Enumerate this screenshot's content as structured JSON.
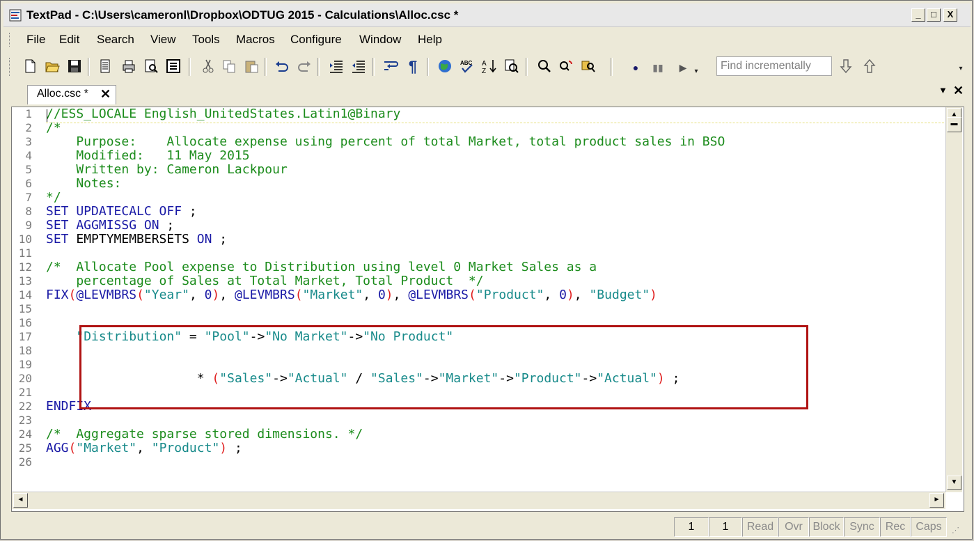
{
  "window": {
    "title": "TextPad - C:\\Users\\cameronl\\Dropbox\\ODTUG 2015 - Calculations\\Alloc.csc *",
    "buttons": {
      "minimize": "_",
      "maximize": "□",
      "close": "X"
    }
  },
  "menu": [
    "File",
    "Edit",
    "Search",
    "View",
    "Tools",
    "Macros",
    "Configure",
    "Window",
    "Help"
  ],
  "toolbar": {
    "icons": [
      "new-file-icon",
      "open-folder-icon",
      "save-icon",
      "page-icon",
      "print-icon",
      "print-preview-icon",
      "document-properties-icon",
      "cut-icon",
      "copy-icon",
      "paste-icon",
      "undo-icon",
      "redo-icon",
      "indent-icon",
      "outdent-icon",
      "word-wrap-icon",
      "pilcrow-icon",
      "web-browser-icon",
      "spell-check-icon",
      "sort-icon",
      "compare-icon",
      "find-icon",
      "find-next-icon",
      "find-in-files-icon",
      "record-macro-icon",
      "pause-macro-icon",
      "play-macro-icon"
    ],
    "find_placeholder": "Find incrementally"
  },
  "tab": {
    "label": "Alloc.csc *",
    "close": "✕"
  },
  "editor": {
    "line_numbers": [
      "1",
      "2",
      "3",
      "4",
      "5",
      "6",
      "7",
      "8",
      "9",
      "10",
      "11",
      "12",
      "13",
      "14",
      "15",
      "16",
      "17",
      "18",
      "19",
      "20",
      "21",
      "22",
      "23",
      "24",
      "25",
      "26"
    ]
  },
  "status": {
    "line": "1",
    "col": "1",
    "fields": [
      "Read",
      "Ovr",
      "Block",
      "Sync",
      "Rec",
      "Caps"
    ]
  },
  "colors": {
    "comment": "#1c8c1c",
    "keyword": "#1a1aa6",
    "string": "#178a8a",
    "paren": "#e01e1e",
    "highlight_box": "#b01313"
  }
}
